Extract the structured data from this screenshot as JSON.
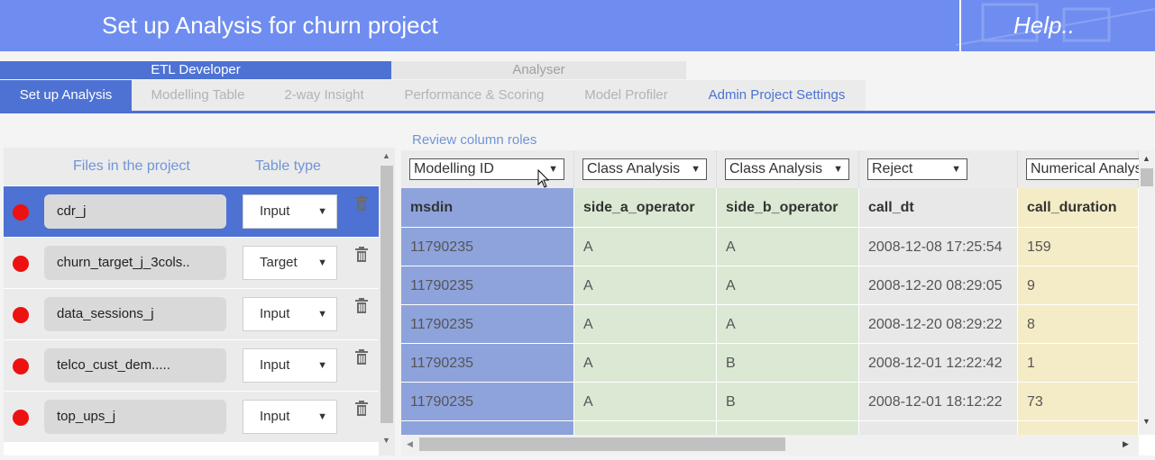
{
  "header": {
    "title": "Set up Analysis for churn project",
    "help": "Help.."
  },
  "roles": {
    "etl": "ETL Developer",
    "analyser": "Analyser"
  },
  "tabs": [
    "Set up Analysis",
    "Modelling Table",
    "2-way Insight",
    "Performance & Scoring",
    "Model Profiler",
    "Admin Project Settings"
  ],
  "files": {
    "header_files": "Files in the project",
    "header_type": "Table type",
    "items": [
      {
        "name": "cdr_j",
        "type": "Input"
      },
      {
        "name": "churn_target_j_3cols..",
        "type": "Target"
      },
      {
        "name": "data_sessions_j",
        "type": "Input"
      },
      {
        "name": "telco_cust_dem.....",
        "type": "Input"
      },
      {
        "name": "top_ups_j",
        "type": "Input"
      }
    ]
  },
  "grid": {
    "caption": "Review column roles",
    "columns": [
      {
        "role": "Modelling ID",
        "name": "msdin",
        "values": [
          "11790235",
          "11790235",
          "11790235",
          "11790235",
          "11790235",
          ""
        ]
      },
      {
        "role": "Class Analysis",
        "name": "side_a_operator",
        "values": [
          "A",
          "A",
          "A",
          "A",
          "A",
          ""
        ]
      },
      {
        "role": "Class Analysis",
        "name": "side_b_operator",
        "values": [
          "A",
          "A",
          "A",
          "B",
          "B",
          ""
        ]
      },
      {
        "role": "Reject",
        "name": "call_dt",
        "values": [
          "2008-12-08 17:25:54",
          "2008-12-20 08:29:05",
          "2008-12-20 08:29:22",
          "2008-12-01 12:22:42",
          "2008-12-01 18:12:22",
          ""
        ]
      },
      {
        "role": "Numerical Analysis",
        "name": "call_duration",
        "values": [
          "159",
          "9",
          "8",
          "1",
          "73",
          ""
        ]
      }
    ]
  }
}
